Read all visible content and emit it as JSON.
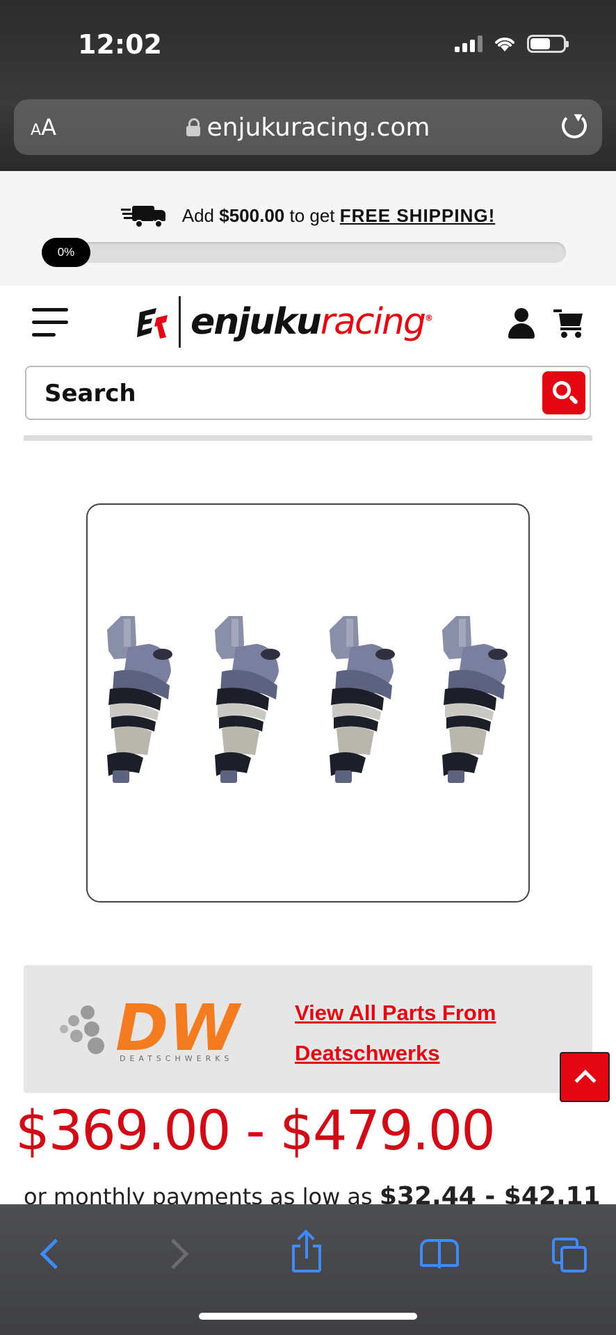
{
  "status_bar": {
    "time": "12:02"
  },
  "browser": {
    "text_size_label": "AA",
    "url": "enjukuracing.com"
  },
  "shipping": {
    "prefix": "Add",
    "amount": "$500.00",
    "middle": "to get",
    "free_label": "FREE SHIPPING!",
    "progress_label": "0%",
    "progress_value": 0
  },
  "header": {
    "logo_brand_a": "enjuku",
    "logo_brand_b": "racing",
    "search_placeholder": "Search"
  },
  "brand": {
    "logo_text": "DW",
    "logo_subtext": "DEATSCHWERKS",
    "link_line1": "View All Parts From",
    "link_line2": "Deatschwerks"
  },
  "product": {
    "price_range": "$369.00 - $479.00",
    "monthly_prefix": "or monthly payments as low as",
    "monthly_range": "$32.44 - $42.11"
  },
  "colors": {
    "accent_red": "#e30613",
    "safari_blue": "#3d8bff"
  }
}
